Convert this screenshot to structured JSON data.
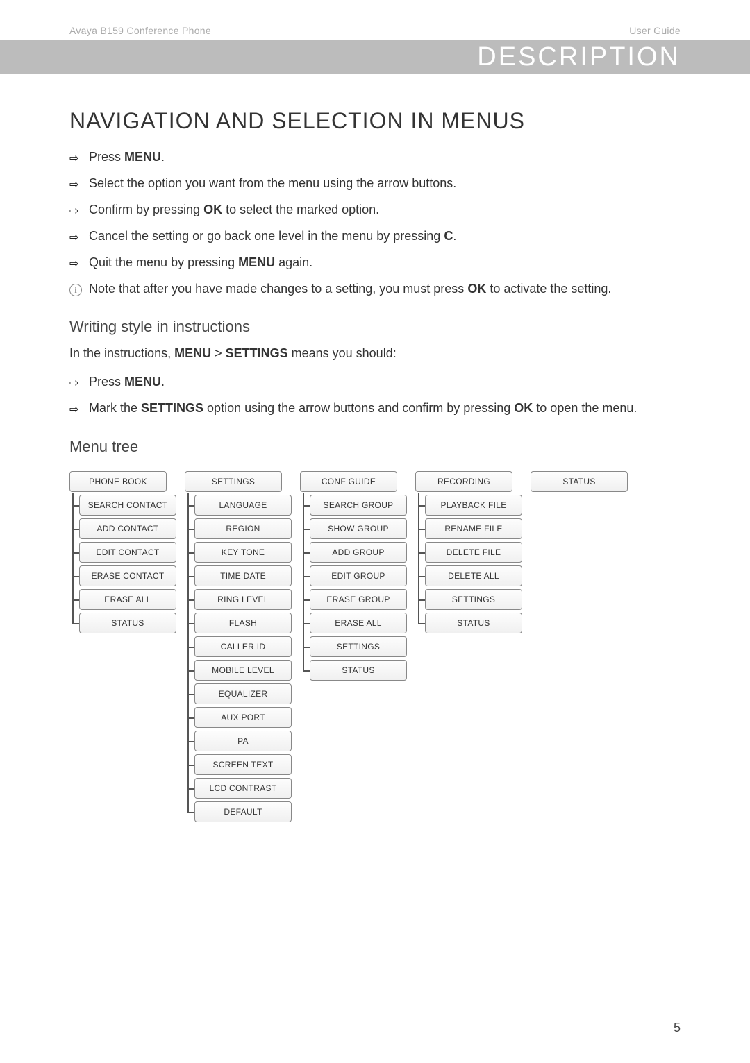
{
  "header": {
    "left": "Avaya B159 Conference Phone",
    "right": "User Guide"
  },
  "band": {
    "title": "DESCRIPTION"
  },
  "main_heading": "NAVIGATION AND SELECTION IN MENUS",
  "steps": [
    {
      "pre": "Press ",
      "bold": "MENU",
      "post": "."
    },
    {
      "pre": "Select the option you want from the menu using the arrow buttons.",
      "bold": "",
      "post": ""
    },
    {
      "pre": "Confirm by pressing ",
      "bold": "OK",
      "post": " to select the marked option."
    },
    {
      "pre": "Cancel the setting or go back one level in the menu by pressing ",
      "bold": "C",
      "post": "."
    },
    {
      "pre": "Quit the menu by pressing ",
      "bold": "MENU",
      "post": " again."
    }
  ],
  "note": {
    "pre": "Note that after you have made changes to a setting, you must press ",
    "bold": "OK",
    "post": " to activate the setting."
  },
  "writing_head": "Writing style in instructions",
  "writing_para": {
    "pre": "In the instructions,  ",
    "bold": "MENU",
    "mid": " > ",
    "bold2": "SETTINGS",
    "post": " means you should:"
  },
  "writing_steps": [
    {
      "pre": "Press ",
      "bold": "MENU",
      "post": "."
    },
    {
      "pre": "Mark the ",
      "bold": "SETTINGS",
      "post": " option using the arrow buttons and confirm by pressing ",
      "bold2": "OK",
      "post2": " to open the menu."
    }
  ],
  "tree_head": "Menu tree",
  "tree": [
    {
      "head": "PHONE BOOK",
      "items": [
        "SEARCH CONTACT",
        "ADD CONTACT",
        "EDIT CONTACT",
        "ERASE CONTACT",
        "ERASE ALL",
        "STATUS"
      ]
    },
    {
      "head": "SETTINGS",
      "items": [
        "LANGUAGE",
        "REGION",
        "KEY TONE",
        "TIME DATE",
        "RING LEVEL",
        "FLASH",
        "CALLER ID",
        "MOBILE LEVEL",
        "EQUALIZER",
        "AUX PORT",
        "PA",
        "SCREEN TEXT",
        "LCD CONTRAST",
        "DEFAULT"
      ]
    },
    {
      "head": "CONF GUIDE",
      "items": [
        "SEARCH GROUP",
        "SHOW GROUP",
        "ADD GROUP",
        "EDIT GROUP",
        "ERASE GROUP",
        "ERASE ALL",
        "SETTINGS",
        "STATUS"
      ]
    },
    {
      "head": "RECORDING",
      "items": [
        "PLAYBACK FILE",
        "RENAME FILE",
        "DELETE FILE",
        "DELETE ALL",
        "SETTINGS",
        "STATUS"
      ]
    },
    {
      "head": "STATUS",
      "items": []
    }
  ],
  "page_number": "5"
}
